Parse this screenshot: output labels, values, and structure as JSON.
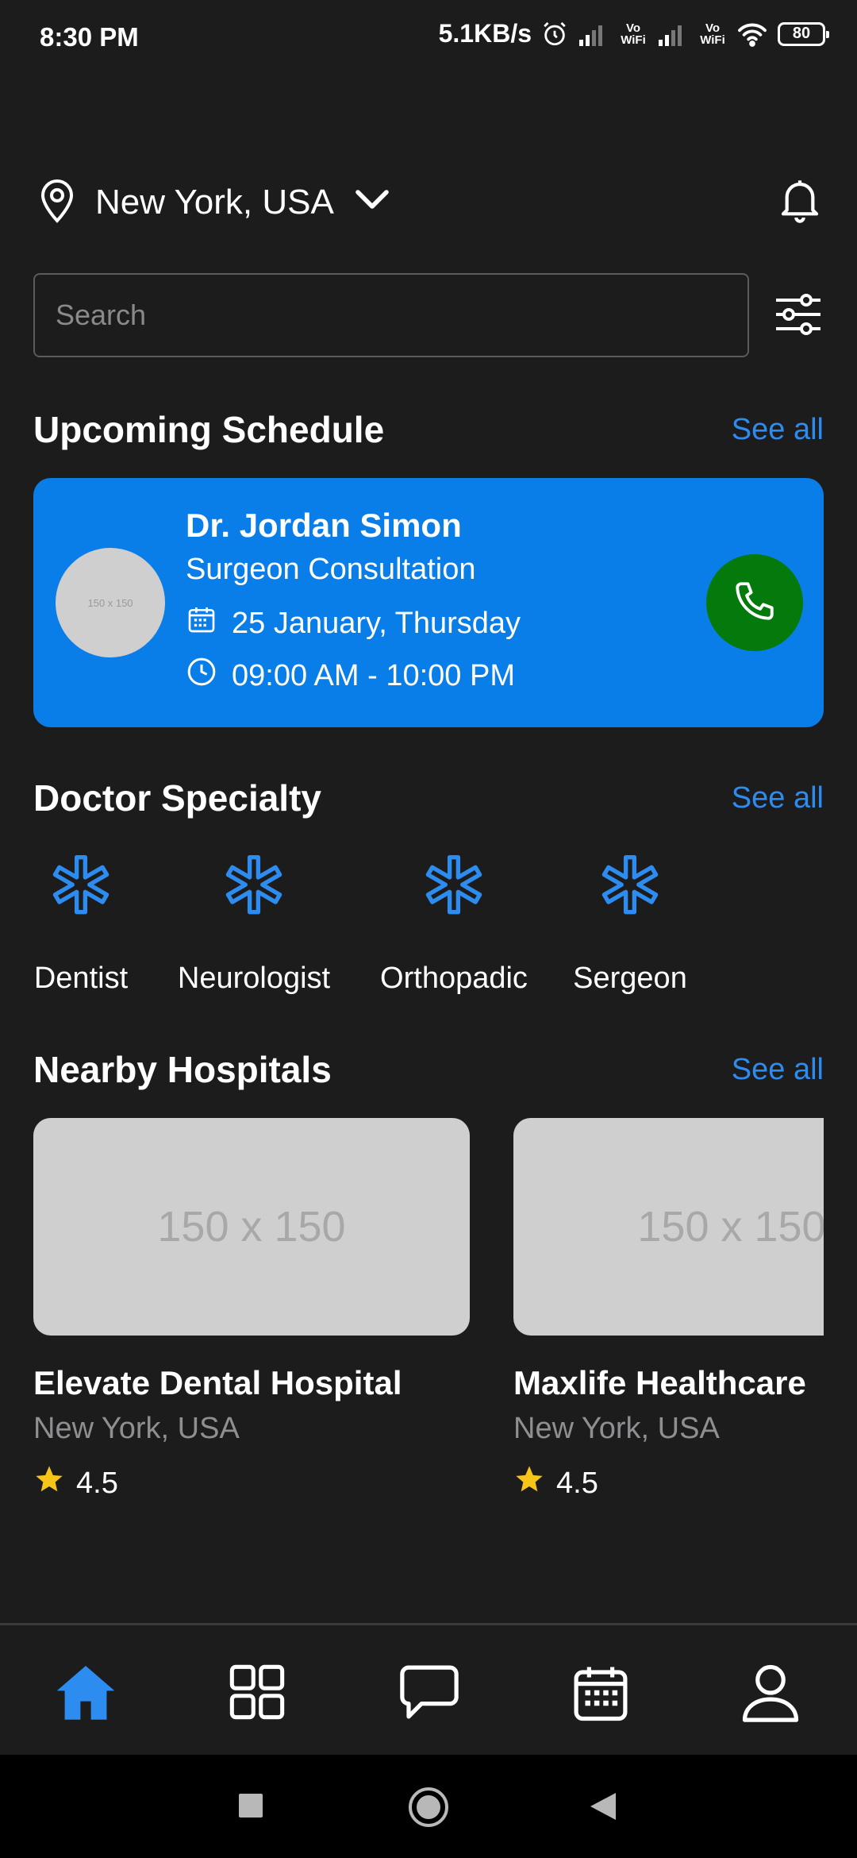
{
  "status_bar": {
    "time": "8:30 PM",
    "net_speed": "5.1KB/s",
    "vowifi_label_1": "Vo\nWiFi",
    "vowifi_label_2": "Vo\nWiFi",
    "battery": "80"
  },
  "header": {
    "location": "New York, USA",
    "icons": [
      "location-pin-icon",
      "chevron-down-icon",
      "bell-icon"
    ]
  },
  "search": {
    "placeholder": "Search",
    "value": "",
    "filter_icon": "sliders-icon"
  },
  "schedule": {
    "title": "Upcoming Schedule",
    "see_all": "See all",
    "card": {
      "avatar_placeholder": "150 x 150",
      "doctor_name": "Dr. Jordan Simon",
      "specialty": "Surgeon Consultation",
      "date": "25 January, Thursday",
      "time": "09:00 AM - 10:00 PM",
      "call_icon": "phone-icon"
    },
    "colors": {
      "card_bg": "#0a7ee8",
      "call_bg": "#047a0c"
    }
  },
  "specialty": {
    "title": "Doctor Specialty",
    "see_all": "See all",
    "items": [
      {
        "label": "Dentist",
        "icon": "asterisk-icon"
      },
      {
        "label": "Neurologist",
        "icon": "asterisk-icon"
      },
      {
        "label": "Orthopadic",
        "icon": "asterisk-icon"
      },
      {
        "label": "Sergeon",
        "icon": "asterisk-icon"
      }
    ]
  },
  "hospitals": {
    "title": "Nearby Hospitals",
    "see_all": "See all",
    "items": [
      {
        "image_placeholder": "150 x 150",
        "name": "Elevate Dental Hospital",
        "location": "New York, USA",
        "rating": "4.5"
      },
      {
        "image_placeholder": "150 x 150",
        "name": "Maxlife Healthcare",
        "location": "New York, USA",
        "rating": "4.5"
      }
    ]
  },
  "bottom_nav": {
    "items": [
      "home-icon",
      "grid-icon",
      "chat-icon",
      "calendar-icon",
      "profile-icon"
    ],
    "active": "home-icon"
  },
  "colors": {
    "background": "#1c1c1d",
    "accent": "#2d8cf0",
    "star": "#f5c518"
  }
}
